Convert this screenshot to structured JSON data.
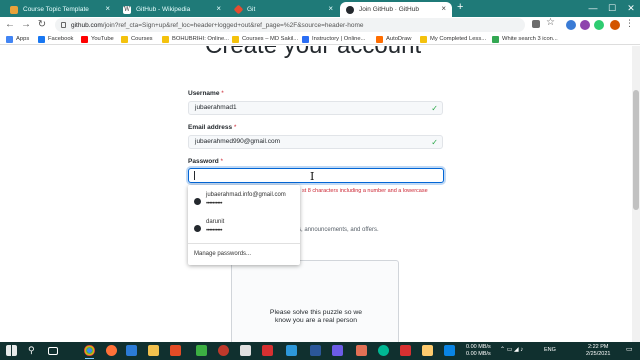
{
  "tabs": [
    {
      "label": "Course Topic Template",
      "color": "#e8a23a"
    },
    {
      "label": "GitHub - Wikipedia",
      "color": "#fff"
    },
    {
      "label": "Git",
      "color": "#e44c30"
    },
    {
      "label": "Join GitHub · GitHub",
      "color": "#24292e"
    }
  ],
  "address": {
    "host": "github.com",
    "path": "/join?ref_cta=Sign+up&ref_loc=header+logged+out&ref_page=%2F&source=header-home"
  },
  "bookmarks": [
    {
      "label": "Apps",
      "color": "#4285f4"
    },
    {
      "label": "Facebook",
      "color": "#1877f2"
    },
    {
      "label": "YouTube",
      "color": "#ff0000"
    },
    {
      "label": "Courses",
      "color": "#f4c20d"
    },
    {
      "label": "BOHUBRIHI: Online...",
      "color": "#f4c20d"
    },
    {
      "label": "Courses – MD Sakil...",
      "color": "#f4c20d"
    },
    {
      "label": "Instructory | Online...",
      "color": "#2a6df4"
    },
    {
      "label": "AutoDraw",
      "color": "#ff6d00"
    },
    {
      "label": "My Completed Less...",
      "color": "#f4c20d"
    },
    {
      "label": "White search 3 icon...",
      "color": "#34a853"
    }
  ],
  "page": {
    "heading": "Create your account",
    "username_label": "Username",
    "username_value": "jubaerahmad1",
    "email_label": "Email address",
    "email_value": "jubaerahmed990@gmail.com",
    "password_label": "Password",
    "required_mark": "*",
    "password_hint": "st 8 characters including a number and a lowercase",
    "bg_text": "s, announcements, and offers.",
    "captcha_line1": "Please solve this puzzle so we",
    "captcha_line2": "know you are a real person"
  },
  "autofill": {
    "items": [
      {
        "user": "jubaerahmad.info@gmail.com",
        "dots": "••••••••••"
      },
      {
        "user": "darunit",
        "dots": "••••••••••"
      }
    ],
    "manage_label": "Manage passwords..."
  },
  "tray": {
    "net_up": "0.00 MB/s",
    "net_down": "0.00 MB/s",
    "lang": "ENG",
    "time": "2:22 PM",
    "date": "2/25/2021"
  },
  "window_controls": {
    "minimize": "—",
    "maximize": "☐",
    "close": "✕"
  },
  "new_tab": "+",
  "close_glyph": "×"
}
